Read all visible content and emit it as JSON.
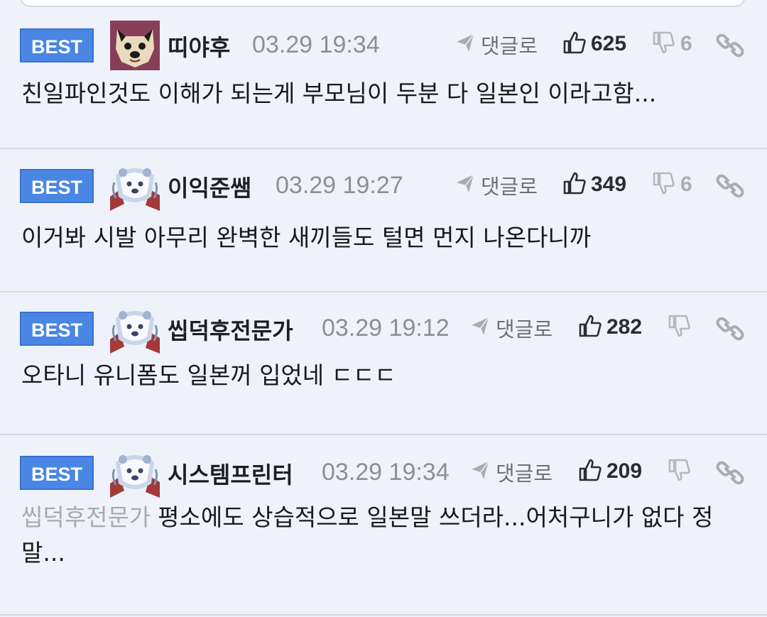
{
  "comments": [
    {
      "badge": "BEST",
      "avatar": "shiba-avatar",
      "nickname": "띠야후",
      "time": "03.29 19:34",
      "reply_label": "댓글로",
      "likes": "625",
      "dislikes": "6",
      "mention": "",
      "text": "친일파인것도 이해가 되는게 부모님이 두분 다 일본인 이라고함..."
    },
    {
      "badge": "BEST",
      "avatar": "polar-bear-avatar",
      "nickname": "이익준쌤",
      "time": "03.29 19:27",
      "reply_label": "댓글로",
      "likes": "349",
      "dislikes": "6",
      "mention": "",
      "text": "이거봐 시발 아무리 완벽한 새끼들도 털면 먼지 나온다니까"
    },
    {
      "badge": "BEST",
      "avatar": "polar-bear-avatar",
      "nickname": "씹덕후전문가",
      "time": "03.29 19:12",
      "reply_label": "댓글로",
      "likes": "282",
      "dislikes": "",
      "mention": "",
      "text": "오타니 유니폼도 일본꺼 입었네 ㄷㄷㄷ"
    },
    {
      "badge": "BEST",
      "avatar": "polar-bear-avatar",
      "nickname": "시스템프린터",
      "time": "03.29 19:34",
      "reply_label": "댓글로",
      "likes": "209",
      "dislikes": "",
      "mention": "씹덕후전문가",
      "text": "평소에도 상습적으로 일본말 쓰더라...어처구니가 없다 정말..."
    }
  ],
  "colors": {
    "badge": "#4a86e3",
    "background": "#eff2fa",
    "muted": "#8c9096",
    "divider": "#d6d9e0"
  },
  "icons": {
    "reply": "send-arrow-icon",
    "like": "thumbs-up-icon",
    "dislike": "thumbs-down-icon",
    "link": "link-icon"
  }
}
